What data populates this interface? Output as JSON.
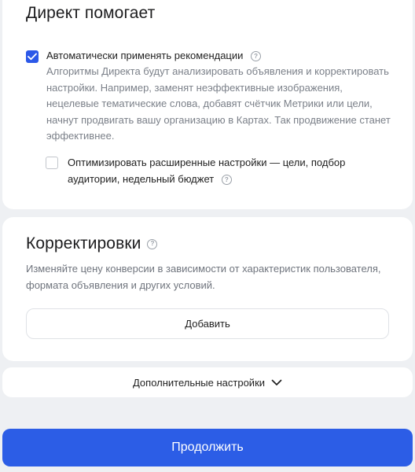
{
  "section_direct_helps": {
    "title": "Директ помогает",
    "auto_apply": {
      "label": "Автоматически применять рекомендации",
      "checked": true,
      "description": "Алгоритмы Директа будут анализировать объявления и корректировать настройки. Например, заменят неэффективные изображения, нецелевые тематические слова, добавят счётчик Метрики или цели, начнут продвигать вашу организацию в Картах. Так продвижение станет эффективнее."
    },
    "optimize_advanced": {
      "label": "Оптимизировать расширенные настройки — цели, подбор аудитории, недельный бюджет",
      "checked": false
    }
  },
  "section_adjustments": {
    "title": "Корректировки",
    "description": "Изменяйте цену конверсии в зависимости от характеристик пользователя, формата объявления и других условий.",
    "add_label": "Добавить"
  },
  "more_settings_label": "Дополнительные настройки",
  "continue_label": "Продолжить",
  "colors": {
    "accent": "#2c5de6",
    "checkbox_checked": "#2c58e8",
    "background": "#eef0f3"
  },
  "icons": {
    "help": "question-circle",
    "check": "checkmark",
    "chevron": "chevron-down"
  }
}
